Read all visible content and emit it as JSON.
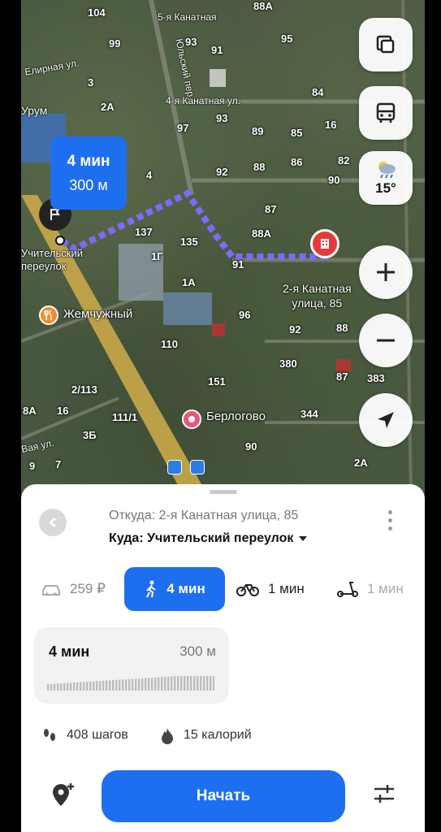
{
  "map": {
    "streets": [
      "5-я Канатная",
      "Елирная ул.",
      "4-я Канатная ул.",
      "Урум",
      "Учительский\nпереулок",
      "Юльский пер.",
      "Вая ул."
    ],
    "houses": [
      "104",
      "88А",
      "99",
      "93",
      "91",
      "95",
      "3",
      "84",
      "2А",
      "97",
      "93",
      "89",
      "85",
      "16",
      "82",
      "4",
      "92",
      "88",
      "86",
      "90",
      "87",
      "137",
      "88А",
      "135",
      "1Г",
      "91",
      "1А",
      "96",
      "88",
      "110",
      "92",
      "380",
      "383",
      "151",
      "87",
      "2/113",
      "111/1",
      "344",
      "3Б",
      "90",
      "2А",
      "8А",
      "16",
      "9",
      "7"
    ],
    "pois": {
      "zhemchuzhny": "Жемчужный",
      "berlogovo": "Берлогово"
    },
    "destination_label": "2-я Канатная\nулица, 85",
    "route_bubble": {
      "time": "4 мин",
      "distance": "300 м"
    },
    "weather": {
      "temp": "15°"
    },
    "colors": {
      "route": "#7b6cf6",
      "accent": "#1e6ff0",
      "marker": "#e63a3a"
    }
  },
  "sheet": {
    "from": "Откуда: 2-я Канатная улица, 85",
    "to": "Куда: Учительский переулок",
    "modes": [
      {
        "name": "car",
        "value": "259 ₽"
      },
      {
        "name": "walk",
        "value": "4 мин"
      },
      {
        "name": "bike",
        "value": "1 мин"
      },
      {
        "name": "scooter",
        "value": "1 мин"
      }
    ],
    "card": {
      "time": "4 мин",
      "distance": "300 м"
    },
    "stats": {
      "steps": "408 шагов",
      "calories": "15 калорий"
    },
    "start": "Начать"
  }
}
